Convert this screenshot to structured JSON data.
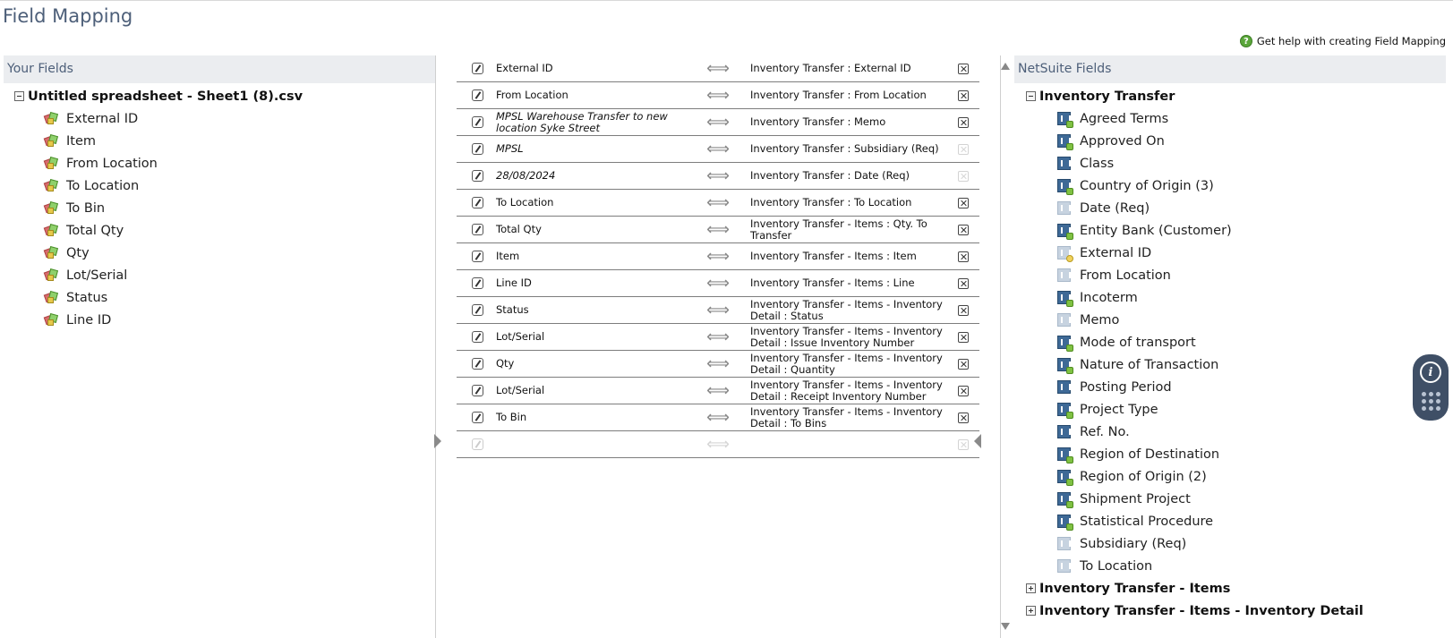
{
  "page": {
    "title": "Field Mapping",
    "help_link": "Get help with creating Field Mapping"
  },
  "your_fields": {
    "header": "Your Fields",
    "file_name": "Untitled spreadsheet - Sheet1 (8).csv",
    "items": [
      "External ID",
      "Item",
      "From Location",
      "To Location",
      "To Bin",
      "Total Qty",
      "Qty",
      "Lot/Serial",
      "Status",
      "Line ID"
    ]
  },
  "mappings": [
    {
      "source": "External ID",
      "target": "Inventory Transfer : External ID"
    },
    {
      "source": "From Location",
      "target": "Inventory Transfer : From Location"
    },
    {
      "source": "MPSL Warehouse Transfer to new location Syke Street",
      "target": "Inventory Transfer : Memo"
    },
    {
      "source": "MPSL",
      "target": "Inventory Transfer : Subsidiary (Req)"
    },
    {
      "source": "28/08/2024",
      "target": "Inventory Transfer : Date (Req)"
    },
    {
      "source": "To Location",
      "target": "Inventory Transfer : To Location"
    },
    {
      "source": "Total Qty",
      "target": "Inventory Transfer - Items : Qty. To Transfer"
    },
    {
      "source": "Item",
      "target": "Inventory Transfer - Items : Item"
    },
    {
      "source": "Line ID",
      "target": "Inventory Transfer - Items : Line"
    },
    {
      "source": "Status",
      "target": "Inventory Transfer - Items - Inventory Detail : Status"
    },
    {
      "source": "Lot/Serial",
      "target": "Inventory Transfer - Items - Inventory Detail : Issue Inventory Number"
    },
    {
      "source": "Qty",
      "target": "Inventory Transfer - Items - Inventory Detail : Quantity"
    },
    {
      "source": "Lot/Serial",
      "target": "Inventory Transfer - Items - Inventory Detail : Receipt Inventory Number"
    },
    {
      "source": "To Bin",
      "target": "Inventory Transfer - Items - Inventory Detail : To Bins"
    },
    {
      "source": "",
      "target": ""
    }
  ],
  "netsuite_fields": {
    "header": "NetSuite Fields",
    "record": "Inventory Transfer",
    "items": [
      "Agreed Terms",
      "Approved On",
      "Class",
      "Country of Origin (3)",
      "Date (Req)",
      "Entity Bank (Customer)",
      "External ID",
      "From Location",
      "Incoterm",
      "Memo",
      "Mode of transport",
      "Nature of Transaction",
      "Posting Period",
      "Project Type",
      "Ref. No.",
      "Region of Destination",
      "Region of Origin (2)",
      "Shipment Project",
      "Statistical Procedure",
      "Subsidiary (Req)",
      "To Location"
    ],
    "sublists": [
      "Inventory Transfer - Items",
      "Inventory Transfer - Items - Inventory Detail"
    ]
  },
  "colors": {
    "title": "#4d5f79",
    "header_bg": "#ebedf0",
    "netsuite_icon": "#3e6996",
    "widget_bg": "#3f4f66"
  },
  "icons": {
    "info": "i"
  }
}
